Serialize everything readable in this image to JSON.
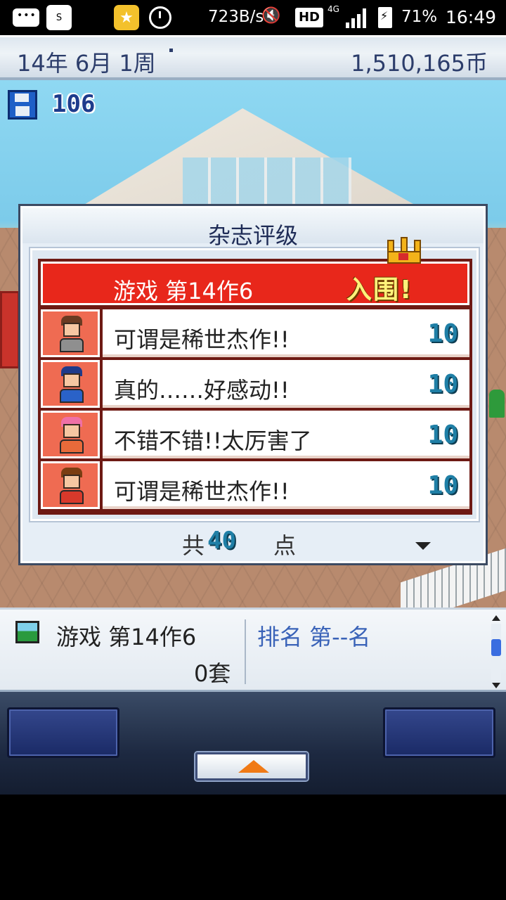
{
  "status_bar": {
    "network_speed": "723B/s",
    "hd_label": "HD",
    "network_type": "4G",
    "battery": "71%",
    "time": "16:49",
    "icons": [
      "message-icon",
      "sim-icon",
      "star-app-icon",
      "timer-icon",
      "mute-icon",
      "hd-icon",
      "signal-icon",
      "battery-icon"
    ]
  },
  "top_bar": {
    "date": "14年 6月 1周",
    "money": "1,510,165币"
  },
  "scene": {
    "save_count": "106"
  },
  "dialog": {
    "title": "杂志评级",
    "game_name": "游戏 第14作6",
    "status": "入围!",
    "reviews": [
      {
        "comment": "可谓是稀世杰作!!",
        "score": "10",
        "hair": "#6b3b22",
        "outfit": "#8f8f8f"
      },
      {
        "comment": "真的……好感动!!",
        "score": "10",
        "hair": "#1f3a8a",
        "outfit": "#2a62c8"
      },
      {
        "comment": "不错不错!!太厉害了",
        "score": "10",
        "hair": "#f070a6",
        "outfit": "#e86a3a"
      },
      {
        "comment": "可谓是稀世杰作!!",
        "score": "10",
        "hair": "#7a3d12",
        "outfit": "#d8392b"
      }
    ],
    "total_prefix": "共",
    "total_value": "40",
    "total_suffix": "点"
  },
  "info_panel": {
    "game_title": "游戏 第14作6",
    "units_sold": "0套",
    "rank": "排名 第--名"
  },
  "colors": {
    "header_red": "#e8271b",
    "score_blue": "#1f7fa6",
    "nominated_yellow": "#fff27a",
    "rank_blue": "#3a63b8"
  }
}
